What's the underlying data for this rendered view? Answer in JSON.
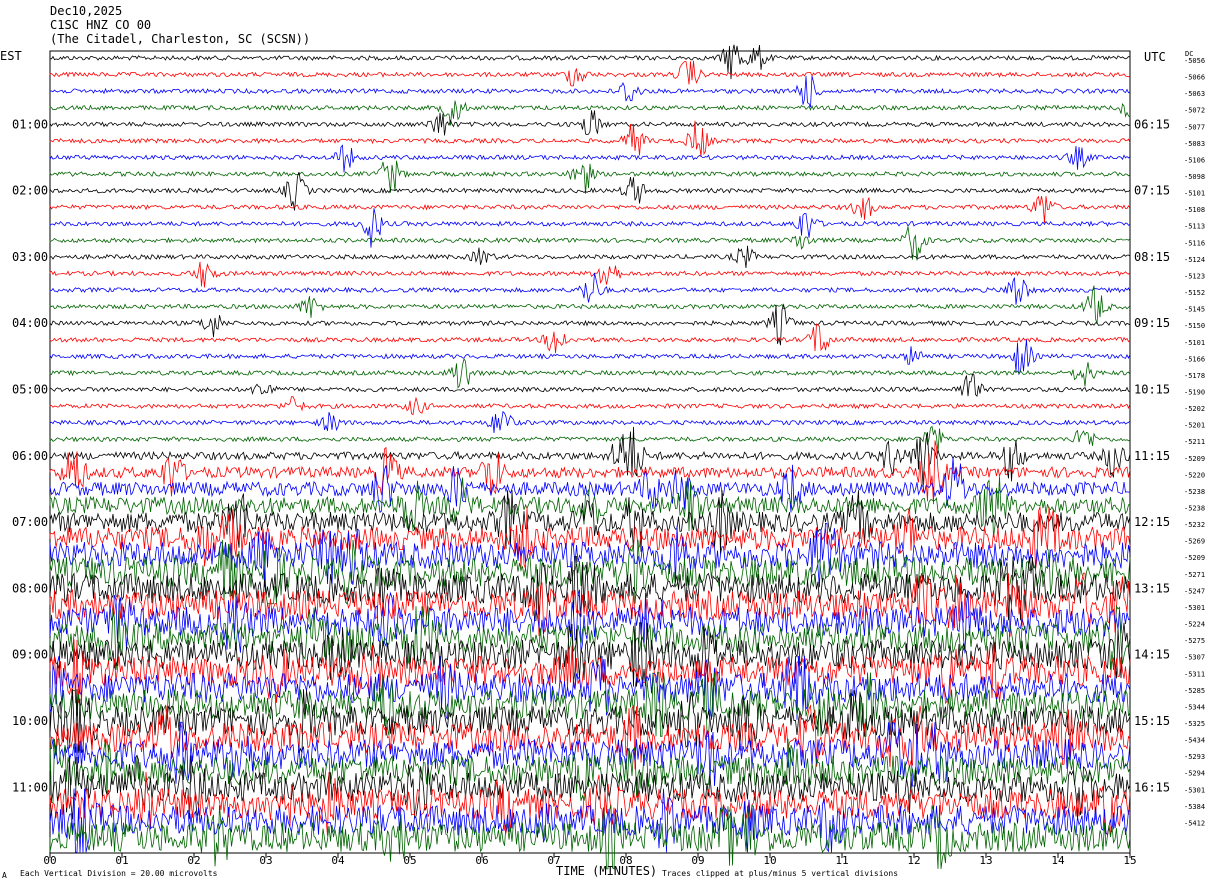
{
  "header": {
    "date": "Dec10,2025",
    "station": "C1SC HNZ CO 00",
    "location": "(The Citadel, Charleston, SC (SCSN))"
  },
  "left_tz": "EST",
  "right_tz": "UTC",
  "dc_label": "DC",
  "footer": {
    "scale_note": "Each Vertical Division = 20.00 microvolts",
    "clip_note": "Traces clipped at plus/minus 5 vertical divisions",
    "corner_mark": "A"
  },
  "colors": {
    "trace_cycle": [
      "#000000",
      "#ff0000",
      "#0000ff",
      "#006400"
    ]
  },
  "chart_data": {
    "type": "line",
    "title": "Dec10,2025 C1SC HNZ CO 00 (The Citadel, Charleston, SC (SCSN))",
    "xlabel": "TIME (MINUTES)",
    "ylabel": "",
    "xlim": [
      0,
      15
    ],
    "x_ticks": [
      "00",
      "01",
      "02",
      "03",
      "04",
      "05",
      "06",
      "07",
      "08",
      "09",
      "10",
      "11",
      "12",
      "13",
      "14",
      "15"
    ],
    "rows": 48,
    "row_minutes": 15,
    "left_ticks": [
      {
        "row": 4,
        "label": "01:00"
      },
      {
        "row": 8,
        "label": "02:00"
      },
      {
        "row": 12,
        "label": "03:00"
      },
      {
        "row": 16,
        "label": "04:00"
      },
      {
        "row": 20,
        "label": "05:00"
      },
      {
        "row": 24,
        "label": "06:00"
      },
      {
        "row": 28,
        "label": "07:00"
      },
      {
        "row": 32,
        "label": "08:00"
      },
      {
        "row": 36,
        "label": "09:00"
      },
      {
        "row": 40,
        "label": "10:00"
      },
      {
        "row": 44,
        "label": "11:00"
      }
    ],
    "right_ticks": [
      {
        "row": 4,
        "label": "06:15"
      },
      {
        "row": 8,
        "label": "07:15"
      },
      {
        "row": 12,
        "label": "08:15"
      },
      {
        "row": 16,
        "label": "09:15"
      },
      {
        "row": 20,
        "label": "10:15"
      },
      {
        "row": 24,
        "label": "11:15"
      },
      {
        "row": 28,
        "label": "12:15"
      },
      {
        "row": 32,
        "label": "13:15"
      },
      {
        "row": 36,
        "label": "14:15"
      },
      {
        "row": 40,
        "label": "15:15"
      },
      {
        "row": 44,
        "label": "16:15"
      }
    ],
    "dc_offsets": [
      -5056,
      -5066,
      -5063,
      -5072,
      -5077,
      -5083,
      -5106,
      -5098,
      -5101,
      -5108,
      -5113,
      -5116,
      -5124,
      -5123,
      -5152,
      -5145,
      -5150,
      -5101,
      -5166,
      -5178,
      -5190,
      -5202,
      -5201,
      -5211,
      -5209,
      -5220,
      -5238,
      -5238,
      -5232,
      -5269,
      -5209,
      -5271,
      -5247,
      -5301,
      -5224,
      -5275,
      -5307,
      -5311,
      -5285,
      -5344,
      -5325,
      -5434,
      -5293,
      -5294,
      -5301,
      -5384,
      -5412
    ],
    "colors_cycle": [
      "black",
      "red",
      "blue",
      "green"
    ],
    "noise_level_note": "amplitude grows strongly from row ~24 (06:00 EST) onward",
    "clipping_divisions": 5
  }
}
